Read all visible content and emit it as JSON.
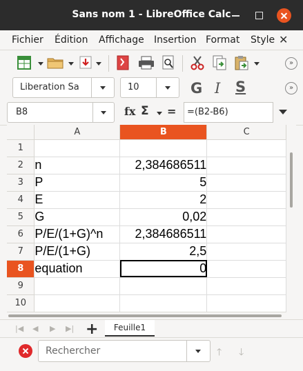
{
  "window": {
    "title": "Sans nom 1 - LibreOffice Calc"
  },
  "menubar": {
    "items": [
      "Fichier",
      "Édition",
      "Affichage",
      "Insertion",
      "Format",
      "Style"
    ]
  },
  "toolbar": {
    "font_name": "Liberation Sa",
    "font_size": "10"
  },
  "formula_bar": {
    "cell_ref": "B8",
    "formula": "=(B2-B6)",
    "fx": "fx",
    "sigma": "Σ",
    "equals": "="
  },
  "grid": {
    "columns": [
      "A",
      "B",
      "C"
    ],
    "selected_column": "B",
    "selected_row": 8,
    "rows": [
      {
        "num": "1",
        "a": "",
        "b": ""
      },
      {
        "num": "2",
        "a": "n",
        "b": "2,384686511"
      },
      {
        "num": "3",
        "a": "P",
        "b": "5"
      },
      {
        "num": "4",
        "a": "E",
        "b": "2"
      },
      {
        "num": "5",
        "a": "G",
        "b": "0,02"
      },
      {
        "num": "6",
        "a": "P/E/(1+G)^n",
        "b": "2,384686511"
      },
      {
        "num": "7",
        "a": "P/E/(1+G)",
        "b": "2,5"
      },
      {
        "num": "8",
        "a": "equation",
        "b": "0"
      },
      {
        "num": "9",
        "a": "",
        "b": ""
      },
      {
        "num": "10",
        "a": "",
        "b": ""
      }
    ]
  },
  "sheets": {
    "tabs": [
      "Feuille1"
    ],
    "add_label": "+"
  },
  "find": {
    "placeholder": "Rechercher"
  },
  "colors": {
    "accent": "#e95420",
    "titlebar": "#2c2c2c"
  }
}
